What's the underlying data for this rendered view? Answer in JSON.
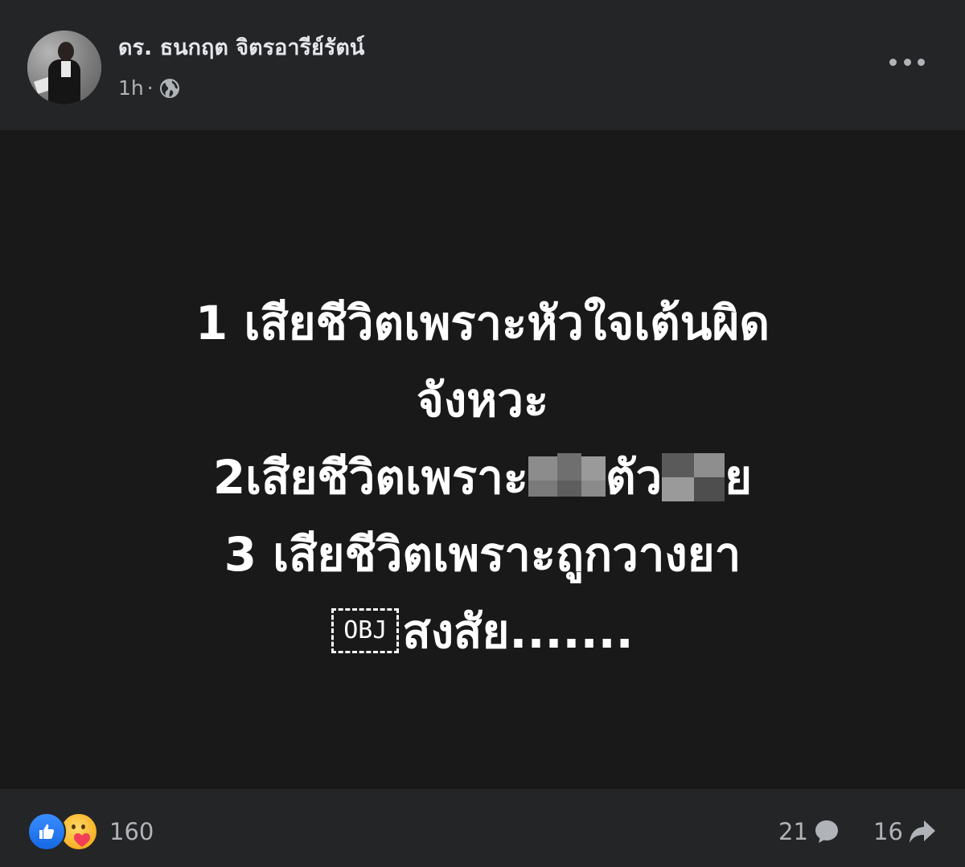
{
  "post": {
    "author_name": "ดร. ธนกฤต จิตรอารีย์รัตน์",
    "timestamp": "1h",
    "separator": "·",
    "privacy_icon": "globe-icon",
    "more_icon": "more-options-icon"
  },
  "card": {
    "background": "#191919",
    "text_color": "#ffffff",
    "line1": "1 เสียชีวิตเพราะหัวใจเต้นผิด",
    "line2": "จังหวะ",
    "line3_prefix": "2เสียชีวิตเพราะ",
    "line3_mid": "ตัว",
    "line3_suffix": "ย",
    "line4": "3 เสียชีวิตเพราะถูกวางยา",
    "obj_label": "OBJ",
    "line5": "สงสัย......."
  },
  "footer": {
    "reactions_icons": [
      "like-icon",
      "care-icon"
    ],
    "reactions_count": "160",
    "comments_count": "21",
    "comments_icon": "comment-icon",
    "shares_count": "16",
    "shares_icon": "share-icon"
  },
  "colors": {
    "page_bg": "#242526",
    "primary_text": "#e4e6eb",
    "secondary_text": "#b0b3b8",
    "like_blue": "#1668e3",
    "care_yellow": "#f7b125"
  }
}
